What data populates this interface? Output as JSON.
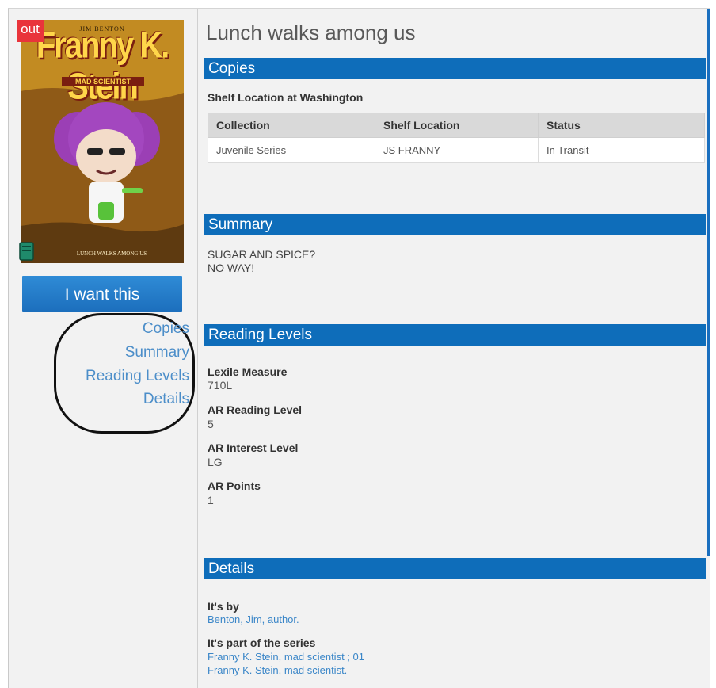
{
  "badge": {
    "out": "out"
  },
  "cover": {
    "author": "JIM BENTON",
    "title": "Franny K. Stein",
    "subtitle": "MAD SCIENTIST",
    "bottom": "LUNCH WALKS AMONG US"
  },
  "actions": {
    "want_label": "I want this"
  },
  "nav": [
    {
      "label": "Copies"
    },
    {
      "label": "Summary"
    },
    {
      "label": "Reading Levels"
    },
    {
      "label": "Details"
    }
  ],
  "title": "Lunch walks among us",
  "copies": {
    "heading": "Copies",
    "shelf_location_label": "Shelf Location at Washington",
    "columns": [
      "Collection",
      "Shelf Location",
      "Status"
    ],
    "rows": [
      [
        "Juvenile Series",
        "JS FRANNY",
        "In Transit"
      ]
    ]
  },
  "summary": {
    "heading": "Summary",
    "lines": [
      "SUGAR AND SPICE?",
      "NO WAY!"
    ]
  },
  "reading_levels": {
    "heading": "Reading Levels",
    "items": [
      {
        "label": "Lexile Measure",
        "value": "710L"
      },
      {
        "label": "AR Reading Level",
        "value": "5"
      },
      {
        "label": "AR Interest Level",
        "value": "LG"
      },
      {
        "label": "AR Points",
        "value": "1"
      }
    ]
  },
  "details": {
    "heading": "Details",
    "by_label": "It's by",
    "author": "Benton, Jim, author.",
    "series_label": "It's part of the series",
    "series": [
      "Franny K. Stein, mad scientist ; 01",
      "Franny K. Stein, mad scientist."
    ]
  },
  "colors": {
    "accent": "#0e6dba",
    "link": "#3a86c8",
    "badge": "#e9343b"
  }
}
